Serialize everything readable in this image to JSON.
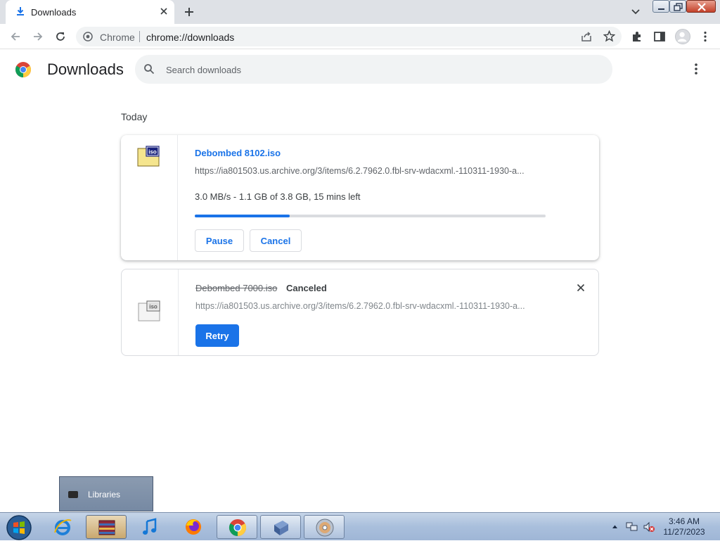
{
  "window": {
    "tab_title": "Downloads",
    "icons": [
      "download-icon",
      "close-icon",
      "plus-icon",
      "chevron-down-icon"
    ]
  },
  "toolbar": {
    "site_label": "Chrome",
    "url": "chrome://downloads",
    "icons": [
      "back-arrow-icon",
      "forward-arrow-icon",
      "reload-icon",
      "share-icon",
      "star-icon",
      "extensions-icon",
      "side-panel-icon",
      "avatar",
      "more-vert-icon"
    ]
  },
  "page": {
    "title": "Downloads",
    "search_placeholder": "Search downloads",
    "section_label": "Today"
  },
  "downloads": [
    {
      "name": "Debombed 8102.iso",
      "url": "https://ia801503.us.archive.org/3/items/6.2.7962.0.fbl-srv-wdacxml.-110311-1930-a...",
      "progress_text": "3.0 MB/s - 1.1 GB of 3.8 GB, 15 mins left",
      "progress": 0.27,
      "buttons": {
        "pause": "Pause",
        "cancel": "Cancel"
      }
    },
    {
      "name": "Debombed 7000.iso",
      "status": "Canceled",
      "url": "https://ia801503.us.archive.org/3/items/6.2.7962.0.fbl-srv-wdacxml.-110311-1930-a...",
      "buttons": {
        "retry": "Retry"
      }
    }
  ],
  "libraries_popup": {
    "label": "Libraries"
  },
  "taskbar": {
    "items": [
      "start-orb",
      "internet-explorer",
      "archive-manager",
      "itunes",
      "firefox",
      "chrome",
      "installer",
      "dvd-player"
    ],
    "clock_time": "3:46 AM",
    "clock_date": "11/27/2023"
  },
  "colors": {
    "accent": "#1a73e8",
    "tabstrip": "#dee1e6",
    "omnibox": "#f1f3f4"
  }
}
